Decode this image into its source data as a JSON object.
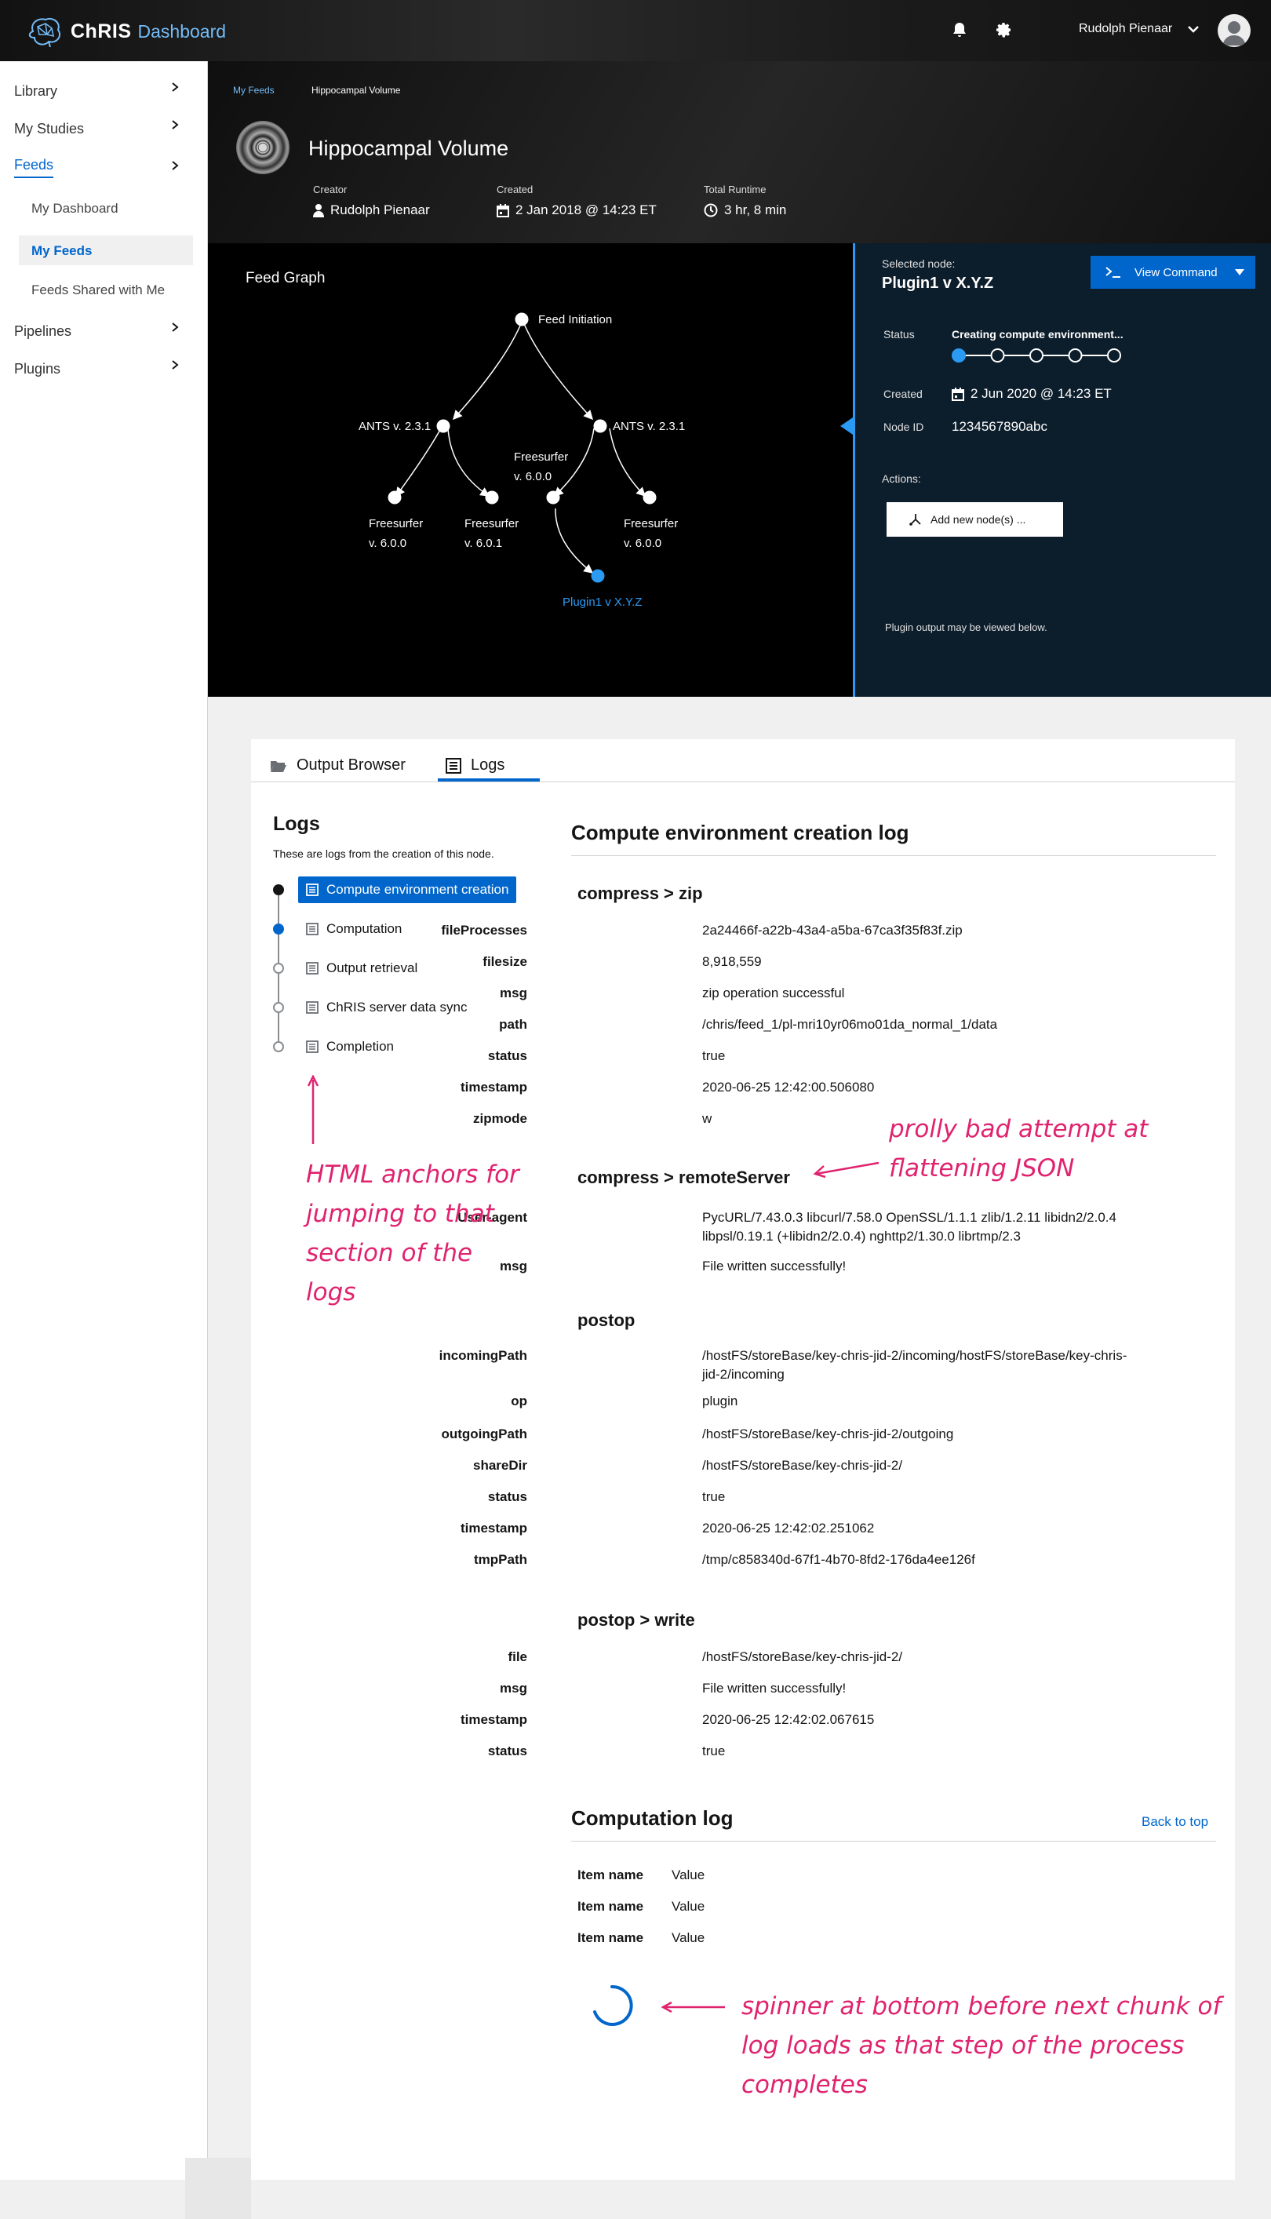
{
  "app": {
    "brand": "ChRIS",
    "subtitle": "Dashboard",
    "user": "Rudolph Pienaar"
  },
  "sidebar": {
    "items": [
      {
        "label": "Library"
      },
      {
        "label": "My Studies"
      },
      {
        "label": "Feeds"
      },
      {
        "label": "Pipelines"
      },
      {
        "label": "Plugins"
      }
    ],
    "feeds_sub": [
      "My Dashboard",
      "My Feeds",
      "Feeds Shared with Me"
    ]
  },
  "breadcrumb": {
    "parent": "My Feeds",
    "current": "Hippocampal Volume"
  },
  "feed": {
    "title": "Hippocampal Volume",
    "creator_label": "Creator",
    "creator": "Rudolph Pienaar",
    "created_label": "Created",
    "created": "2 Jan 2018 @ 14:23 ET",
    "runtime_label": "Total Runtime",
    "runtime": "3 hr, 8 min"
  },
  "graph": {
    "title": "Feed Graph",
    "nodes": {
      "root": "Feed Initiation",
      "ants_left": "ANTS v. 2.3.1",
      "ants_right": "ANTS v. 2.3.1",
      "fs_mid_1": "Freesurfer",
      "fs_mid_2": "v. 6.0.0",
      "fs_a_1": "Freesurfer",
      "fs_a_2": "v. 6.0.0",
      "fs_b_1": "Freesurfer",
      "fs_b_2": "v. 6.0.1",
      "fs_c_1": "Freesurfer",
      "fs_c_2": "v. 6.0.0",
      "plugin": "Plugin1 v X.Y.Z"
    }
  },
  "node_panel": {
    "selected_label": "Selected node:",
    "selected": "Plugin1 v X.Y.Z",
    "view_command": "View Command",
    "status_label": "Status",
    "status_text": "Creating compute environment...",
    "status_steps_total": 5,
    "status_steps_done": 1,
    "created_label": "Created",
    "created": "2 Jun 2020 @ 14:23 ET",
    "node_id_label": "Node ID",
    "node_id": "1234567890abc",
    "actions_label": "Actions:",
    "add_node": "Add new node(s) ...",
    "footnote": "Plugin output may be viewed below."
  },
  "tabs": {
    "output": "Output Browser",
    "logs": "Logs"
  },
  "logs": {
    "title": "Logs",
    "subtitle": "These are logs from the creation of this node.",
    "steps": [
      "Compute environment creation",
      "Computation",
      "Output retrieval",
      "ChRIS server data sync",
      "Completion"
    ]
  },
  "compute_log": {
    "title": "Compute environment creation log",
    "zip_title": "compress > zip",
    "zip": [
      {
        "k": "fileProcesses",
        "v": "2a24466f-a22b-43a4-a5ba-67ca3f35f83f.zip"
      },
      {
        "k": "filesize",
        "v": "8,918,559"
      },
      {
        "k": "msg",
        "v": "zip operation successful"
      },
      {
        "k": "path",
        "v": "/chris/feed_1/pl-mri10yr06mo01da_normal_1/data"
      },
      {
        "k": "status",
        "v": "true"
      },
      {
        "k": "timestamp",
        "v": "2020-06-25 12:42:00.506080"
      },
      {
        "k": "zipmode",
        "v": "w"
      }
    ],
    "remote_title": "compress > remoteServer",
    "remote": [
      {
        "k": "User-agent",
        "v": "PycURL/7.43.0.3 libcurl/7.58.0 OpenSSL/1.1.1 zlib/1.2.11 libidn2/2.0.4 libpsl/0.19.1 (+libidn2/2.0.4) nghttp2/1.30.0 librtmp/2.3"
      },
      {
        "k": "msg",
        "v": "File written successfully!"
      }
    ],
    "postop_title": "postop",
    "postop": [
      {
        "k": "incomingPath",
        "v": "/hostFS/storeBase/key-chris-jid-2/incoming/hostFS/storeBase/key-chris-jid-2/incoming"
      },
      {
        "k": "op",
        "v": "plugin"
      },
      {
        "k": "outgoingPath",
        "v": "/hostFS/storeBase/key-chris-jid-2/outgoing"
      },
      {
        "k": "shareDir",
        "v": "/hostFS/storeBase/key-chris-jid-2/"
      },
      {
        "k": "status",
        "v": "true"
      },
      {
        "k": "timestamp",
        "v": "2020-06-25 12:42:02.251062"
      },
      {
        "k": "tmpPath",
        "v": "/tmp/c858340d-67f1-4b70-8fd2-176da4ee126f"
      }
    ],
    "write_title": "postop > write",
    "write": [
      {
        "k": "file",
        "v": "/hostFS/storeBase/key-chris-jid-2/"
      },
      {
        "k": "msg",
        "v": "File written successfully!"
      },
      {
        "k": "timestamp",
        "v": "2020-06-25 12:42:02.067615"
      },
      {
        "k": "status",
        "v": "true"
      }
    ]
  },
  "computation_log": {
    "title": "Computation log",
    "back_to_top": "Back to top",
    "items": [
      {
        "k": "Item name",
        "v": "Value"
      },
      {
        "k": "Item name",
        "v": "Value"
      },
      {
        "k": "Item name",
        "v": "Value"
      }
    ]
  },
  "annotations": {
    "anchors": [
      "HTML anchors for",
      "jumping to that",
      "section of the",
      "logs"
    ],
    "json": [
      "prolly bad attempt at",
      "flattening JSON"
    ],
    "spinner": [
      "spinner at bottom before next chunk of",
      "log loads as that step of the process",
      "completes"
    ]
  },
  "colors": {
    "accent": "#0066cc",
    "annotation": "#e0236f",
    "panel": "#0c1d2b"
  }
}
